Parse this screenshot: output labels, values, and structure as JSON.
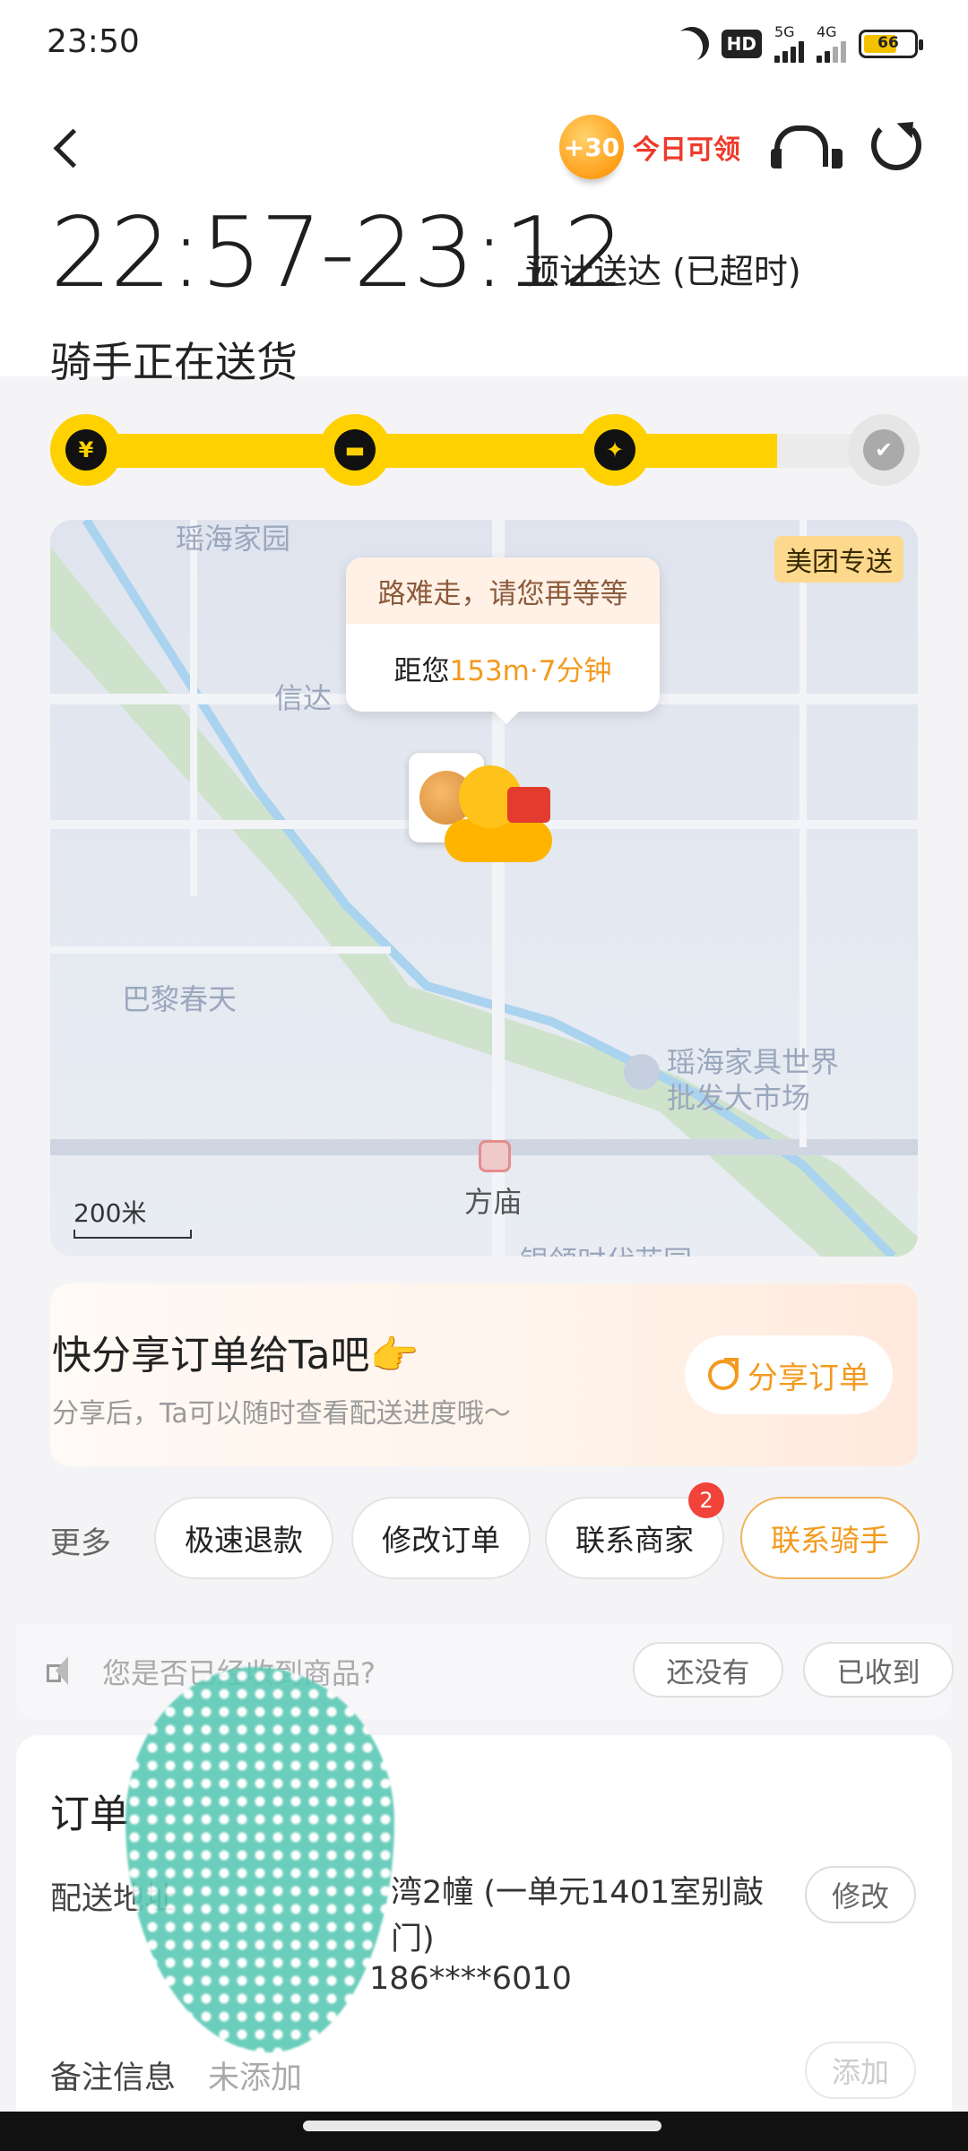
{
  "status_bar": {
    "time": "23:50",
    "hd": "HD",
    "net1": "5G",
    "net2": "4G",
    "battery": "66"
  },
  "header": {
    "coupon_amount": "+30",
    "coupon_label": "今日可领",
    "icons": [
      "back-icon",
      "headset-icon",
      "refresh-icon"
    ]
  },
  "eta": {
    "time": "22:57-23:12",
    "note": "预计送达 (已超时)",
    "status": "骑手正在送货"
  },
  "progress": {
    "fraction": 0.85,
    "steps": [
      {
        "symbol": "¥",
        "icon": "payment-icon"
      },
      {
        "symbol": "▬",
        "icon": "shop-icon"
      },
      {
        "symbol": "✦",
        "icon": "scooter-icon"
      },
      {
        "symbol": "✔",
        "icon": "check-icon"
      }
    ]
  },
  "map": {
    "brand_tag": "美团专送",
    "bubble_top": "路难走，请您再等等",
    "bubble_prefix": "距您",
    "bubble_distance": "153m·7分钟",
    "scale": "200米",
    "labels": {
      "a": "瑶海家园",
      "b": "信达",
      "c": "巴黎春天",
      "d": "瑶海家具世界",
      "e": "批发大市场",
      "f": "方庙",
      "g": "银领时代花园"
    }
  },
  "share": {
    "title": "快分享订单给Ta吧👉",
    "subtitle": "分享后，Ta可以随时查看配送进度哦～",
    "button": "分享订单"
  },
  "more": {
    "label": "更多",
    "actions": [
      "极速退款",
      "修改订单",
      "联系商家",
      "联系骑手"
    ],
    "badge": "2"
  },
  "received": {
    "question": "您是否已经收到商品?",
    "no": "还没有",
    "yes": "已收到"
  },
  "order": {
    "title": "订单",
    "address_label": "配送地址",
    "address_text": "湾2幢 (一单元1401室别敲门)",
    "phone": "186****6010",
    "edit": "修改",
    "note_label": "备注信息",
    "note_value": "未添加",
    "add": "添加"
  },
  "colors": {
    "accent_yellow": "#ffd100",
    "accent_orange": "#f39a1f",
    "coupon_red": "#ee3a2c",
    "badge_red": "#f2433a"
  }
}
